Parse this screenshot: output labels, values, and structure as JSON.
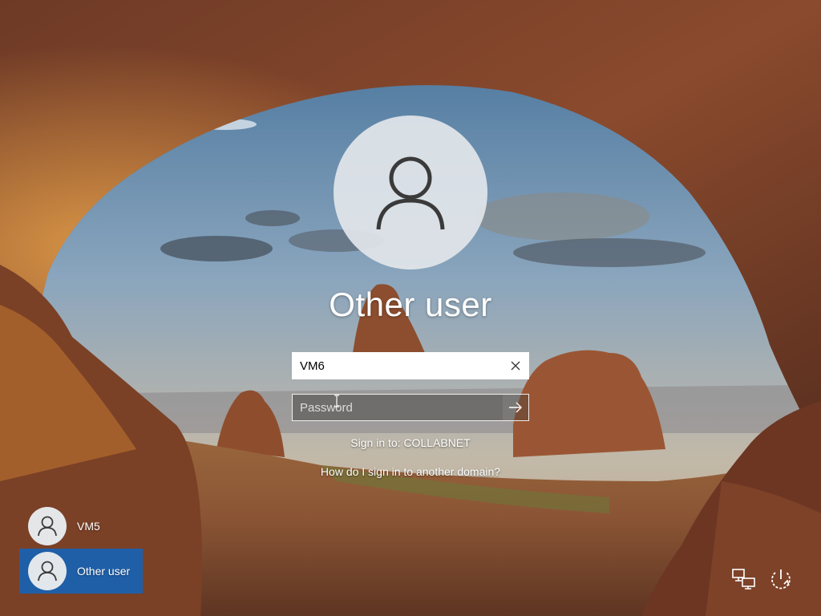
{
  "screen": {
    "type": "windows-lock-screen"
  },
  "main_user": {
    "title": "Other user",
    "avatar_icon": "person-icon"
  },
  "username_field": {
    "value": "VM6",
    "clear_icon": "close-icon"
  },
  "password_field": {
    "placeholder": "Password",
    "value": "",
    "submit_icon": "arrow-right-icon"
  },
  "sign_in_to": "Sign in to: COLLABNET",
  "domain_help_link": "How do I sign in to another domain?",
  "user_list": [
    {
      "name": "VM5",
      "selected": false,
      "icon": "person-icon"
    },
    {
      "name": "Other user",
      "selected": true,
      "icon": "person-icon"
    }
  ],
  "system_icons": [
    {
      "name": "network-icon"
    },
    {
      "name": "power-icon"
    }
  ],
  "colors": {
    "selected_user_bg": "#1f5fa8",
    "text": "#ffffff"
  }
}
